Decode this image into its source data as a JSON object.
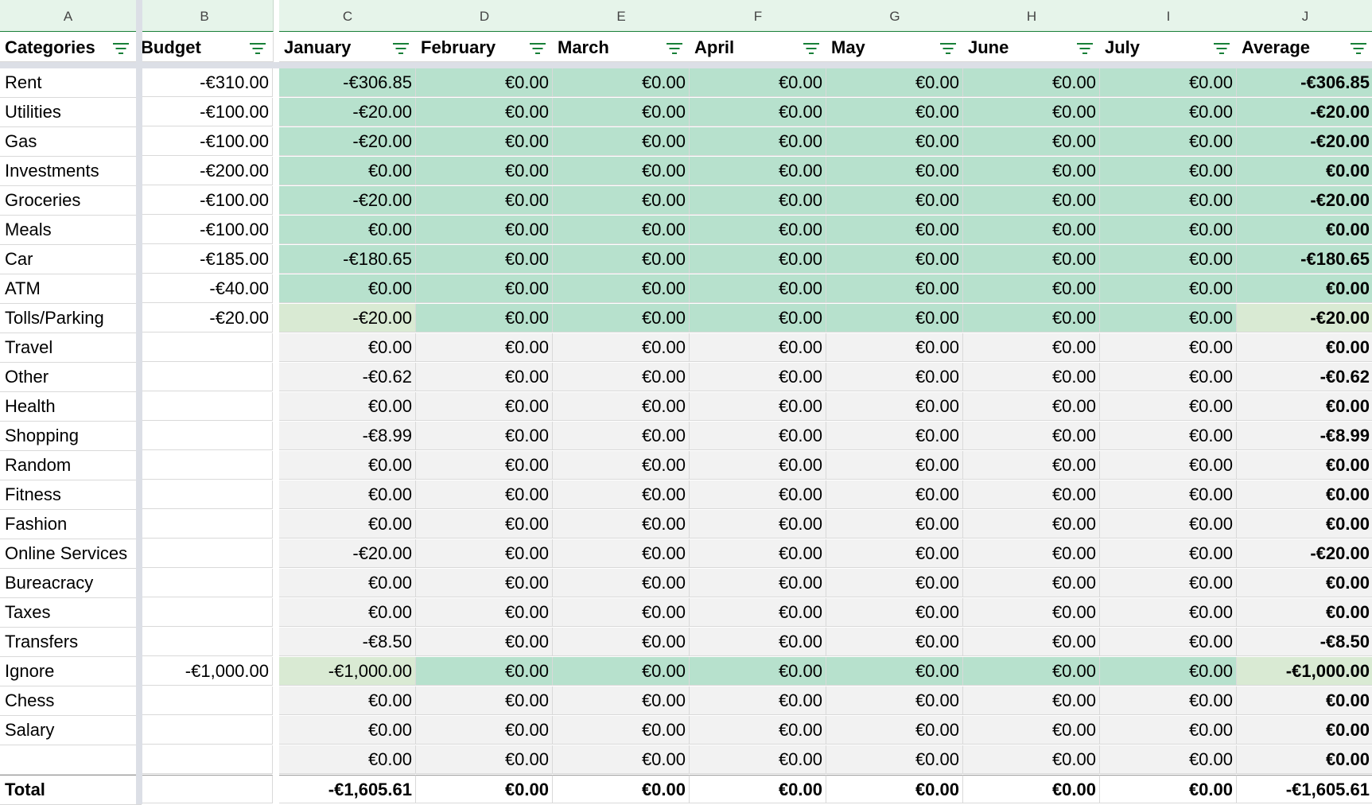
{
  "columns": [
    "A",
    "B",
    "C",
    "D",
    "E",
    "F",
    "G",
    "H",
    "I",
    "J"
  ],
  "headers": [
    "Categories",
    "Budget",
    "January",
    "February",
    "March",
    "April",
    "May",
    "June",
    "July",
    "Average"
  ],
  "rows": [
    {
      "category": "Rent",
      "budget": "-€310.00",
      "months": [
        "-€306.85",
        "€0.00",
        "€0.00",
        "€0.00",
        "€0.00",
        "€0.00",
        "€0.00"
      ],
      "average": "-€306.85",
      "tone": "g"
    },
    {
      "category": "Utilities",
      "budget": "-€100.00",
      "months": [
        "-€20.00",
        "€0.00",
        "€0.00",
        "€0.00",
        "€0.00",
        "€0.00",
        "€0.00"
      ],
      "average": "-€20.00",
      "tone": "g"
    },
    {
      "category": "Gas",
      "budget": "-€100.00",
      "months": [
        "-€20.00",
        "€0.00",
        "€0.00",
        "€0.00",
        "€0.00",
        "€0.00",
        "€0.00"
      ],
      "average": "-€20.00",
      "tone": "g"
    },
    {
      "category": "Investments",
      "budget": "-€200.00",
      "months": [
        "€0.00",
        "€0.00",
        "€0.00",
        "€0.00",
        "€0.00",
        "€0.00",
        "€0.00"
      ],
      "average": "€0.00",
      "tone": "g"
    },
    {
      "category": "Groceries",
      "budget": "-€100.00",
      "months": [
        "-€20.00",
        "€0.00",
        "€0.00",
        "€0.00",
        "€0.00",
        "€0.00",
        "€0.00"
      ],
      "average": "-€20.00",
      "tone": "g"
    },
    {
      "category": "Meals",
      "budget": "-€100.00",
      "months": [
        "€0.00",
        "€0.00",
        "€0.00",
        "€0.00",
        "€0.00",
        "€0.00",
        "€0.00"
      ],
      "average": "€0.00",
      "tone": "g"
    },
    {
      "category": "Car",
      "budget": "-€185.00",
      "months": [
        "-€180.65",
        "€0.00",
        "€0.00",
        "€0.00",
        "€0.00",
        "€0.00",
        "€0.00"
      ],
      "average": "-€180.65",
      "tone": "g"
    },
    {
      "category": "ATM",
      "budget": "-€40.00",
      "months": [
        "€0.00",
        "€0.00",
        "€0.00",
        "€0.00",
        "€0.00",
        "€0.00",
        "€0.00"
      ],
      "average": "€0.00",
      "tone": "g"
    },
    {
      "category": "Tolls/Parking",
      "budget": "-€20.00",
      "months": [
        "-€20.00",
        "€0.00",
        "€0.00",
        "€0.00",
        "€0.00",
        "€0.00",
        "€0.00"
      ],
      "average": "-€20.00",
      "tone": "mixed"
    },
    {
      "category": "Travel",
      "budget": "",
      "months": [
        "€0.00",
        "€0.00",
        "€0.00",
        "€0.00",
        "€0.00",
        "€0.00",
        "€0.00"
      ],
      "average": "€0.00",
      "tone": "gr"
    },
    {
      "category": "Other",
      "budget": "",
      "months": [
        "-€0.62",
        "€0.00",
        "€0.00",
        "€0.00",
        "€0.00",
        "€0.00",
        "€0.00"
      ],
      "average": "-€0.62",
      "tone": "gr"
    },
    {
      "category": "Health",
      "budget": "",
      "months": [
        "€0.00",
        "€0.00",
        "€0.00",
        "€0.00",
        "€0.00",
        "€0.00",
        "€0.00"
      ],
      "average": "€0.00",
      "tone": "gr"
    },
    {
      "category": "Shopping",
      "budget": "",
      "months": [
        "-€8.99",
        "€0.00",
        "€0.00",
        "€0.00",
        "€0.00",
        "€0.00",
        "€0.00"
      ],
      "average": "-€8.99",
      "tone": "gr"
    },
    {
      "category": "Random",
      "budget": "",
      "months": [
        "€0.00",
        "€0.00",
        "€0.00",
        "€0.00",
        "€0.00",
        "€0.00",
        "€0.00"
      ],
      "average": "€0.00",
      "tone": "gr"
    },
    {
      "category": "Fitness",
      "budget": "",
      "months": [
        "€0.00",
        "€0.00",
        "€0.00",
        "€0.00",
        "€0.00",
        "€0.00",
        "€0.00"
      ],
      "average": "€0.00",
      "tone": "gr"
    },
    {
      "category": "Fashion",
      "budget": "",
      "months": [
        "€0.00",
        "€0.00",
        "€0.00",
        "€0.00",
        "€0.00",
        "€0.00",
        "€0.00"
      ],
      "average": "€0.00",
      "tone": "gr"
    },
    {
      "category": "Online Services",
      "budget": "",
      "months": [
        "-€20.00",
        "€0.00",
        "€0.00",
        "€0.00",
        "€0.00",
        "€0.00",
        "€0.00"
      ],
      "average": "-€20.00",
      "tone": "gr"
    },
    {
      "category": "Bureacracy",
      "budget": "",
      "months": [
        "€0.00",
        "€0.00",
        "€0.00",
        "€0.00",
        "€0.00",
        "€0.00",
        "€0.00"
      ],
      "average": "€0.00",
      "tone": "gr"
    },
    {
      "category": "Taxes",
      "budget": "",
      "months": [
        "€0.00",
        "€0.00",
        "€0.00",
        "€0.00",
        "€0.00",
        "€0.00",
        "€0.00"
      ],
      "average": "€0.00",
      "tone": "gr"
    },
    {
      "category": "Transfers",
      "budget": "",
      "months": [
        "-€8.50",
        "€0.00",
        "€0.00",
        "€0.00",
        "€0.00",
        "€0.00",
        "€0.00"
      ],
      "average": "-€8.50",
      "tone": "gr"
    },
    {
      "category": "Ignore",
      "budget": "-€1,000.00",
      "months": [
        "-€1,000.00",
        "€0.00",
        "€0.00",
        "€0.00",
        "€0.00",
        "€0.00",
        "€0.00"
      ],
      "average": "-€1,000.00",
      "tone": "mixed"
    },
    {
      "category": "Chess",
      "budget": "",
      "months": [
        "€0.00",
        "€0.00",
        "€0.00",
        "€0.00",
        "€0.00",
        "€0.00",
        "€0.00"
      ],
      "average": "€0.00",
      "tone": "gr"
    },
    {
      "category": "Salary",
      "budget": "",
      "months": [
        "€0.00",
        "€0.00",
        "€0.00",
        "€0.00",
        "€0.00",
        "€0.00",
        "€0.00"
      ],
      "average": "€0.00",
      "tone": "gr"
    },
    {
      "category": "",
      "budget": "",
      "months": [
        "€0.00",
        "€0.00",
        "€0.00",
        "€0.00",
        "€0.00",
        "€0.00",
        "€0.00"
      ],
      "average": "€0.00",
      "tone": "gr"
    }
  ],
  "total": {
    "label": "Total",
    "months": [
      "-€1,605.61",
      "€0.00",
      "€0.00",
      "€0.00",
      "€0.00",
      "€0.00",
      "€0.00"
    ],
    "average": "-€1,605.61"
  },
  "colors": {
    "within_budget": "#b7e1cd",
    "near_budget": "#d9ead3",
    "no_budget": "#f2f2f2",
    "header_accent": "#188038",
    "column_header_bg": "#e6f4ea"
  }
}
